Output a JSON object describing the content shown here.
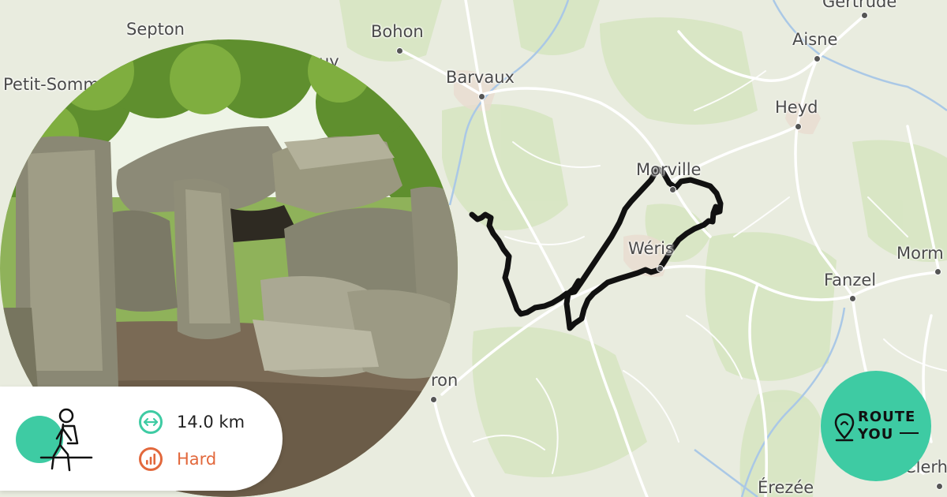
{
  "map": {
    "places": [
      {
        "id": "septon",
        "name": "Septon"
      },
      {
        "id": "bohon",
        "name": "Bohon"
      },
      {
        "id": "barvaux",
        "name": "Barvaux"
      },
      {
        "id": "petit-somme",
        "name": "Petit-Somm"
      },
      {
        "id": "uy",
        "name": "uy"
      },
      {
        "id": "aisne",
        "name": "Aisne"
      },
      {
        "id": "gertrude",
        "name": "Gertrude"
      },
      {
        "id": "heyd",
        "name": "Heyd"
      },
      {
        "id": "morville",
        "name": "Morville"
      },
      {
        "id": "weris",
        "name": "Wéris"
      },
      {
        "id": "fanzel",
        "name": "Fanzel"
      },
      {
        "id": "morm",
        "name": "Morm"
      },
      {
        "id": "oron",
        "name": "ron"
      },
      {
        "id": "erezee",
        "name": "Érezée"
      },
      {
        "id": "clerh",
        "name": "Clerh"
      }
    ],
    "route_color": "#111111",
    "accent_color": "#3ecba3"
  },
  "photo": {
    "subject": "dolmen-stones"
  },
  "route_info": {
    "activity_icon": "hiking-icon",
    "distance": "14.0 km",
    "distance_icon": "distance-arrows-icon",
    "distance_color": "#3ecba3",
    "difficulty": "Hard",
    "difficulty_icon": "difficulty-bars-icon",
    "difficulty_color": "#e2683c"
  },
  "logo": {
    "line1": "ROUTE",
    "line2": "YOU",
    "icon": "map-pin-icon"
  }
}
